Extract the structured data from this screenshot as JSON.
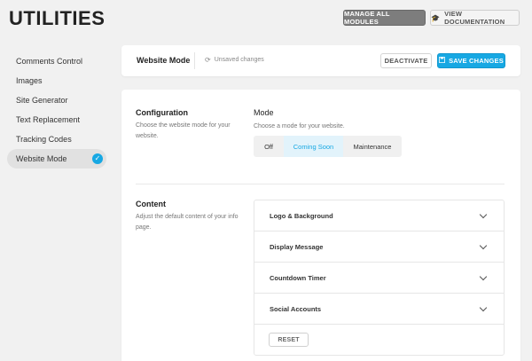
{
  "page": {
    "title": "UTILITIES"
  },
  "top_actions": {
    "manage_all_modules": "MANAGE ALL MODULES",
    "view_documentation": "VIEW DOCUMENTATION"
  },
  "sidebar": {
    "items": [
      {
        "label": "Comments Control",
        "active": false
      },
      {
        "label": "Images",
        "active": false
      },
      {
        "label": "Site Generator",
        "active": false
      },
      {
        "label": "Text Replacement",
        "active": false
      },
      {
        "label": "Tracking Codes",
        "active": false
      },
      {
        "label": "Website Mode",
        "active": true
      }
    ],
    "active_check": "✓"
  },
  "header": {
    "title": "Website Mode",
    "status": "Unsaved changes",
    "deactivate_label": "DEACTIVATE",
    "save_label": "SAVE CHANGES"
  },
  "configuration": {
    "title": "Configuration",
    "description": "Choose the website mode for your website.",
    "mode_label": "Mode",
    "mode_description": "Choose a mode for your website.",
    "modes": [
      "Off",
      "Coming Soon",
      "Maintenance"
    ],
    "selected_mode": "Coming Soon"
  },
  "content": {
    "title": "Content",
    "description": "Adjust the default content of your info page.",
    "sections": [
      "Logo & Background",
      "Display Message",
      "Countdown Timer",
      "Social Accounts"
    ],
    "reset_label": "RESET"
  },
  "colors": {
    "accent": "#17a8e3",
    "manage_button": "#7d7d7d",
    "selected_tab_bg": "#e2f3fb"
  },
  "icons": {
    "docs": "graduation-cap-icon",
    "unsaved": "refresh-icon",
    "save": "floppy-disk-icon",
    "check": "checkmark-icon",
    "chevron": "chevron-down-icon"
  }
}
